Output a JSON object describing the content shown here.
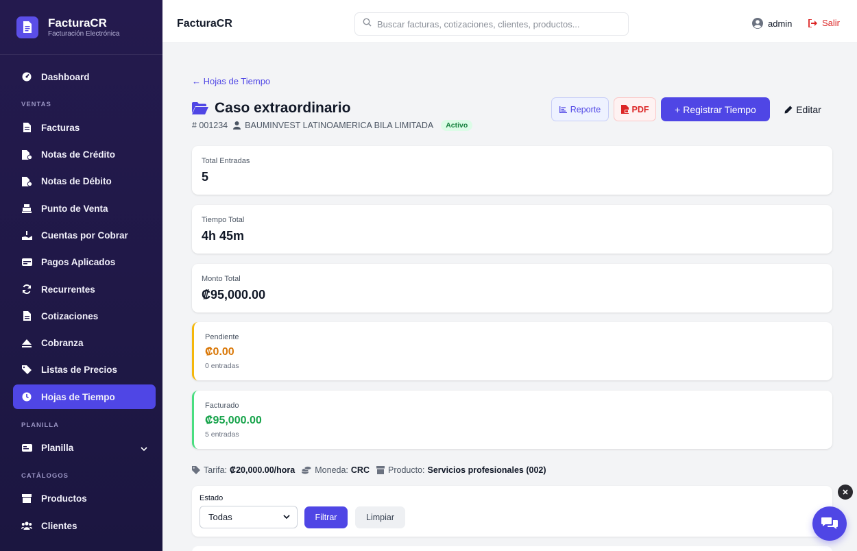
{
  "brand": {
    "name": "FacturaCR",
    "subtitle": "Facturación Electrónica"
  },
  "sidebar": {
    "items_top": [
      {
        "label": "Dashboard",
        "icon": "gauge-icon"
      }
    ],
    "sections": [
      {
        "title": "VENTAS",
        "items": [
          {
            "label": "Facturas",
            "icon": "file-invoice-icon"
          },
          {
            "label": "Notas de Crédito",
            "icon": "file-credit-icon"
          },
          {
            "label": "Notas de Débito",
            "icon": "file-debit-icon"
          },
          {
            "label": "Punto de Venta",
            "icon": "cash-register-icon"
          },
          {
            "label": "Cuentas por Cobrar",
            "icon": "hand-coin-icon"
          },
          {
            "label": "Pagos Aplicados",
            "icon": "money-card-icon"
          },
          {
            "label": "Recurrentes",
            "icon": "sync-icon"
          },
          {
            "label": "Cotizaciones",
            "icon": "file-quote-icon"
          },
          {
            "label": "Cobranza",
            "icon": "eject-icon"
          },
          {
            "label": "Listas de Precios",
            "icon": "tags-icon"
          },
          {
            "label": "Hojas de Tiempo",
            "icon": "clock-icon",
            "active": true
          }
        ]
      },
      {
        "title": "PLANILLA",
        "items": [
          {
            "label": "Planilla",
            "icon": "id-card-icon",
            "expandable": true
          }
        ]
      },
      {
        "title": "CATÁLOGOS",
        "items": [
          {
            "label": "Productos",
            "icon": "box-icon"
          },
          {
            "label": "Clientes",
            "icon": "users-icon"
          }
        ]
      }
    ]
  },
  "topbar": {
    "title": "FacturaCR",
    "search_placeholder": "Buscar facturas, cotizaciones, clientes, productos...",
    "user": "admin",
    "logout": "Salir"
  },
  "page": {
    "back_link": "← Hojas de Tiempo",
    "title": "Caso extraordinario",
    "number": "# 001234",
    "client": "BAUMINVEST LATINOAMERICA BILA LIMITADA",
    "status": "Activo",
    "buttons": {
      "report": "Reporte",
      "pdf": "PDF",
      "register": "+ Registrar Tiempo",
      "edit": "Editar"
    }
  },
  "stats": {
    "total_entries": {
      "label": "Total Entradas",
      "value": "5"
    },
    "total_time": {
      "label": "Tiempo Total",
      "value": "4h 45m"
    },
    "total_amount": {
      "label": "Monto Total",
      "value": "₡95,000.00"
    },
    "pending": {
      "label": "Pendiente",
      "value": "₡0.00",
      "note": "0 entradas"
    },
    "billed": {
      "label": "Facturado",
      "value": "₡95,000.00",
      "note": "5 entradas"
    }
  },
  "meta": {
    "rate_label": "Tarifa:",
    "rate_value": "₡20,000.00/hora",
    "currency_label": "Moneda:",
    "currency_value": "CRC",
    "product_label": "Producto:",
    "product_value": "Servicios profesionales (002)"
  },
  "filter": {
    "label": "Estado",
    "selected": "Todas",
    "filter_button": "Filtrar",
    "clear_button": "Limpiar"
  },
  "colors": {
    "accent": "#4f46e5",
    "warning": "#d97706",
    "success": "#16a34a",
    "danger": "#dc2626"
  }
}
